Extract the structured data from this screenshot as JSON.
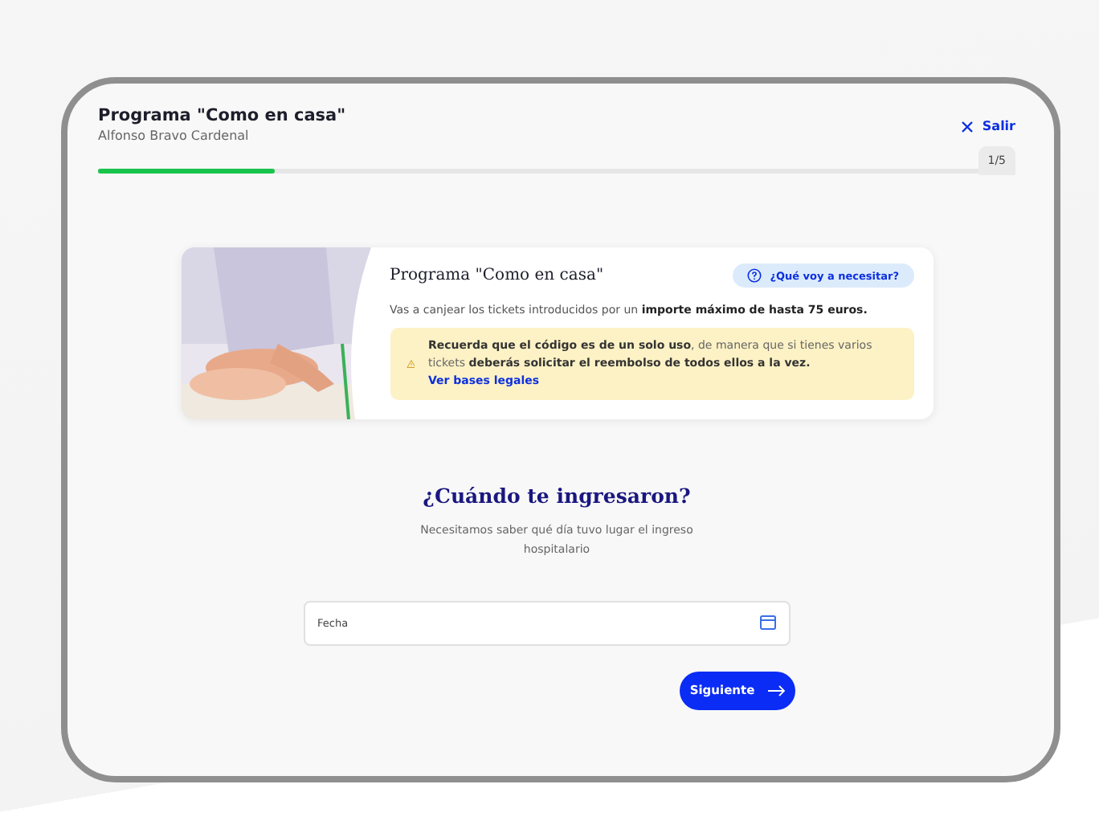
{
  "header": {
    "title": "Programa \"Como en casa\"",
    "subtitle": "Alfonso Bravo Cardenal",
    "exit": "Salir"
  },
  "progress": {
    "level": 0.2,
    "counter": "1/5"
  },
  "card": {
    "title": "Programa \"Como en casa\"",
    "help": "¿Qué voy a necesitar?",
    "text": "Vas a canjear los tickets introducidos por un **importe máximo de hasta 75 euros.**",
    "warning": "**Recuerda que el código es de un solo uso**, de manera que si tienes varios tickets **deberás solicitar el reembolso de todos ellos a la vez.**",
    "link": "Ver bases legales"
  },
  "question": {
    "title": "¿Cuándo te ingresaron?",
    "text": "Necesitamos saber qué día tuvo lugar el ingreso hospitalario"
  },
  "date_field": {
    "label": "Fecha"
  },
  "next_button": "Siguiente"
}
